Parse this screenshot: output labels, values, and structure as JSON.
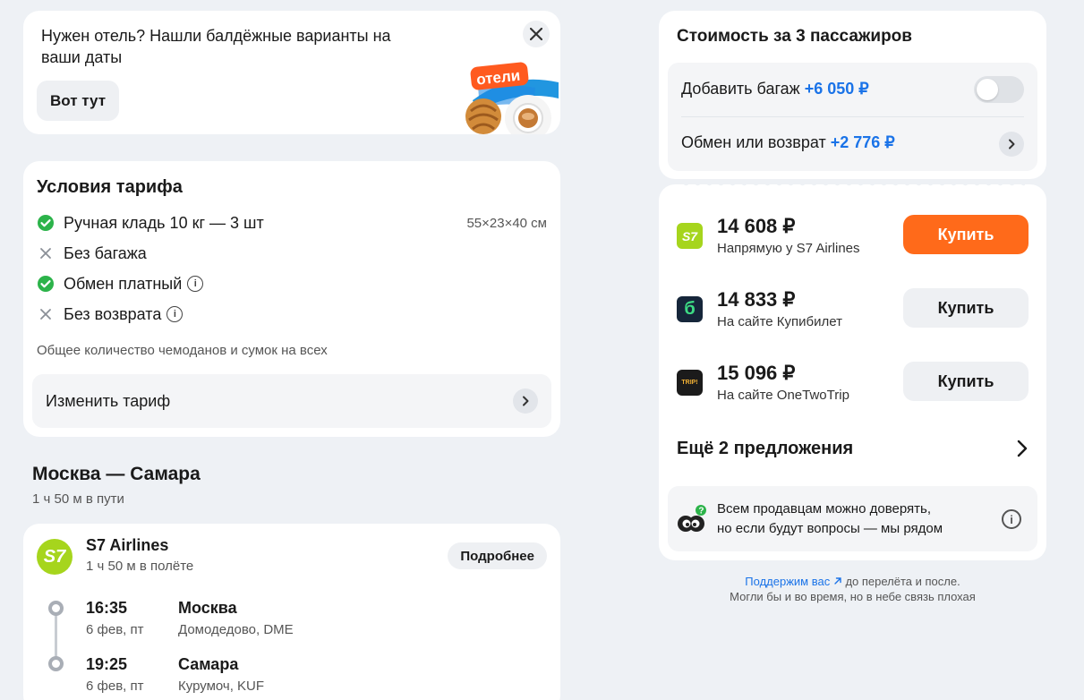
{
  "promo": {
    "text": "Нужен отель? Нашли балдёжные варианты на ваши даты",
    "button": "Вот тут",
    "badge": "отели"
  },
  "tariff": {
    "title": "Условия тарифа",
    "features": [
      {
        "label": "Ручная кладь 10 кг — 3 шт",
        "included": true,
        "extra": "55×23×40 см"
      },
      {
        "label": "Без багажа",
        "included": false
      },
      {
        "label": "Обмен платный",
        "included": true,
        "info": true
      },
      {
        "label": "Без возврата",
        "included": false,
        "info": true
      }
    ],
    "note": "Общее количество чемоданов и сумок на всех",
    "change_label": "Изменить тариф"
  },
  "route": {
    "title": "Москва — Самара",
    "duration": "1 ч 50 м в пути",
    "airline": "S7 Airlines",
    "airline_logo": "S7",
    "flight_time": "1 ч 50 м в полёте",
    "details_button": "Подробнее",
    "departure": {
      "time": "16:35",
      "date": "6 фев, пт",
      "city": "Москва",
      "airport": "Домодедово, DME"
    },
    "arrival": {
      "time": "19:25",
      "date": "6 фев, пт",
      "city": "Самара",
      "airport": "Курумоч, KUF"
    }
  },
  "cost": {
    "title": "Стоимость за 3 пассажиров",
    "baggage_label": "Добавить багаж",
    "baggage_price": "+6 050 ₽",
    "baggage_toggle": false,
    "exchange_label": "Обмен или возврат",
    "exchange_price": "+2 776 ₽"
  },
  "offers": [
    {
      "price": "14 608 ₽",
      "seller": "Напрямую у S7 Airlines",
      "logo": "S7",
      "button": "Купить",
      "primary": true
    },
    {
      "price": "14 833 ₽",
      "seller": "На сайте Купибилет",
      "logo": "б",
      "button": "Купить",
      "primary": false
    },
    {
      "price": "15 096 ₽",
      "seller": "На сайте OneTwoTrip",
      "logo": "TRIP!",
      "button": "Купить",
      "primary": false
    }
  ],
  "more_offers": "Ещё 2 предложения",
  "trust": {
    "line1": "Всем продавцам можно доверять,",
    "line2": "но если будут вопросы — мы рядом"
  },
  "support": {
    "link": "Поддержим вас",
    "link_rest": " до перелёта и после.",
    "line2": "Могли бы и во время, но в небе связь плохая"
  },
  "colors": {
    "accent_orange": "#ff6a1a",
    "price_blue": "#1a73e8",
    "check_green": "#2cb34a",
    "s7_green": "#a6d51d"
  }
}
